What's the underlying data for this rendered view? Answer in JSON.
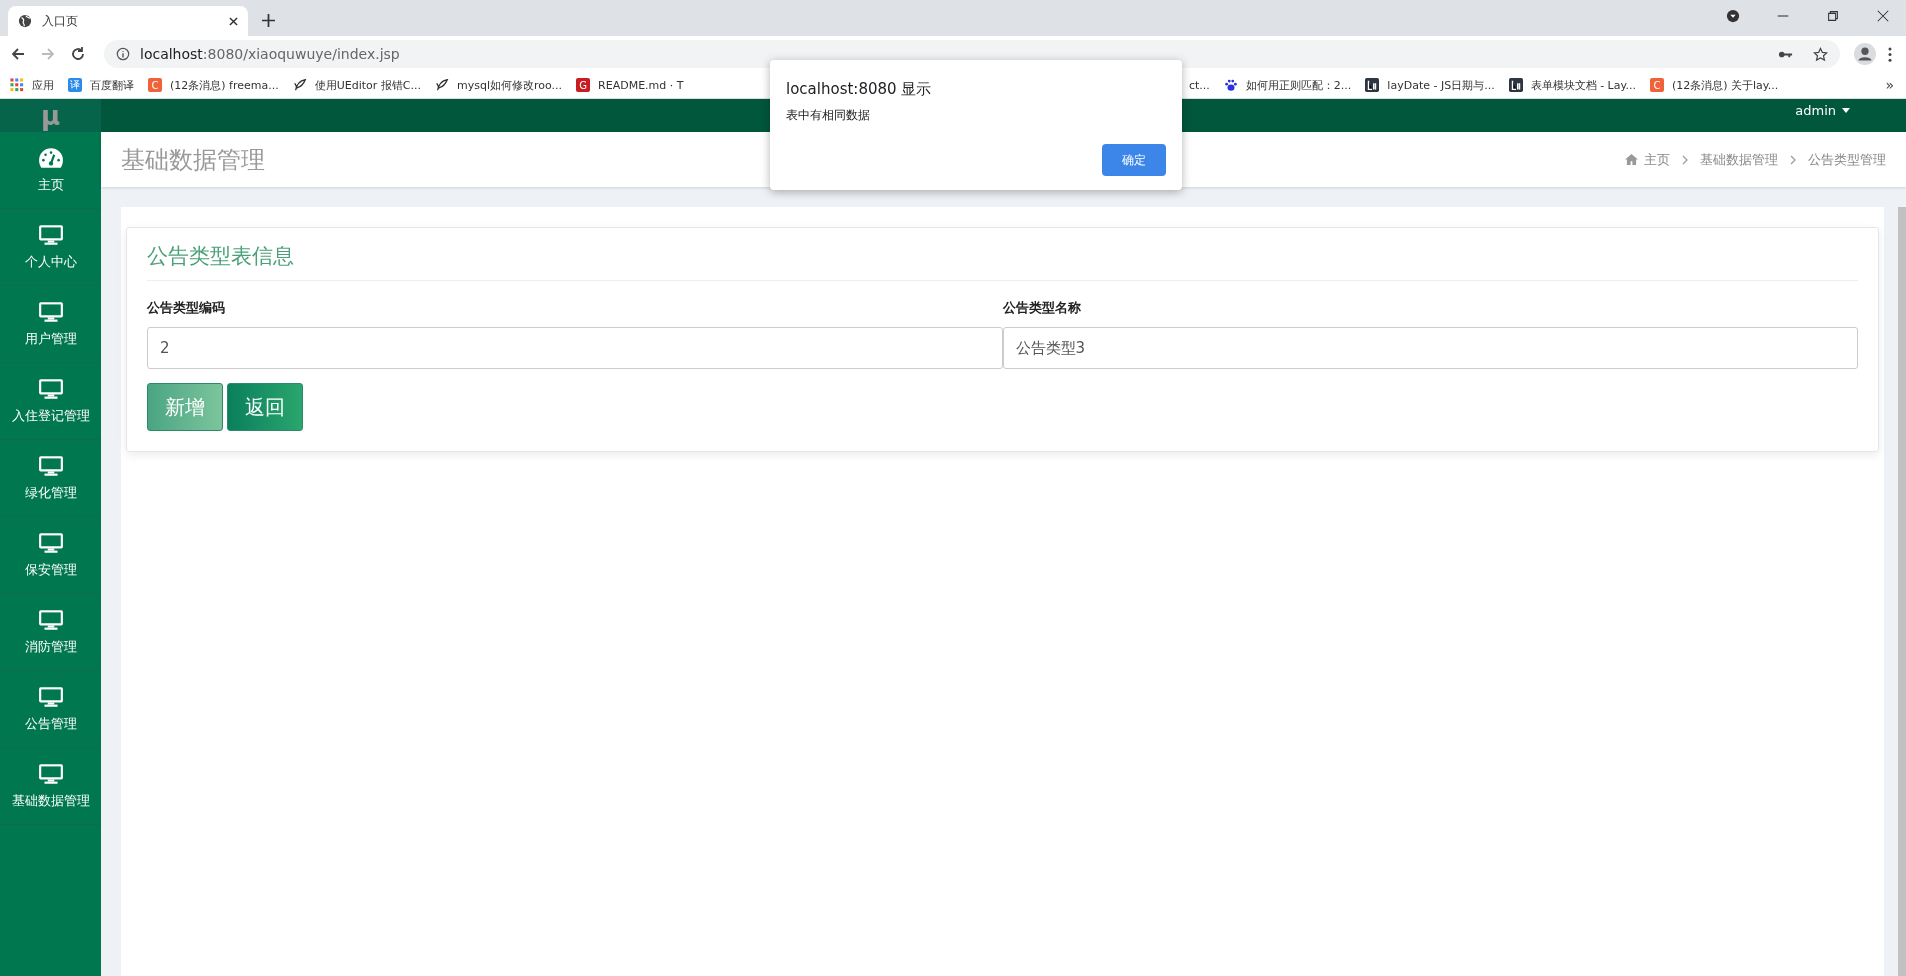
{
  "browser": {
    "tab": {
      "title": "入口页"
    },
    "address": {
      "host": "localhost",
      "rest": ":8080/xiaoquwuye/index.jsp"
    },
    "bookmarks_left": [
      {
        "kind": "apps",
        "label": "应用"
      },
      {
        "kind": "glyph",
        "glyph": "译",
        "color": "#2a8ce8",
        "label": "百度翻译"
      },
      {
        "kind": "glyph",
        "glyph": "C",
        "color": "#f0623a",
        "label": "(12条消息) freema..."
      },
      {
        "kind": "feather",
        "label": "使用UEditor 报错C..."
      },
      {
        "kind": "feather",
        "label": "mysql如何修改roo..."
      },
      {
        "kind": "glyph",
        "glyph": "G",
        "color": "#c71d23",
        "label": "README.md · T"
      }
    ],
    "bookmarks_right": [
      {
        "kind": "none",
        "label": "ct..."
      },
      {
        "kind": "paw",
        "label": "如何用正则匹配：2..."
      },
      {
        "kind": "layui",
        "label": "layDate - JS日期与..."
      },
      {
        "kind": "layui",
        "label": "表单模块文档 - Lay..."
      },
      {
        "kind": "glyph",
        "glyph": "C",
        "color": "#f0623a",
        "label": "(12条消息) 关于lay..."
      }
    ],
    "more": "»"
  },
  "dialog": {
    "title": "localhost:8080 显示",
    "message": "表中有相同数据",
    "ok": "确定"
  },
  "logo": "μ",
  "user": "admin",
  "sidebar": [
    {
      "kind": "dashboard",
      "label": "主页"
    },
    {
      "kind": "monitor",
      "label": "个人中心"
    },
    {
      "kind": "monitor",
      "label": "用户管理"
    },
    {
      "kind": "monitor",
      "label": "入住登记管理"
    },
    {
      "kind": "monitor",
      "label": "绿化管理"
    },
    {
      "kind": "monitor",
      "label": "保安管理"
    },
    {
      "kind": "monitor",
      "label": "消防管理"
    },
    {
      "kind": "monitor",
      "label": "公告管理"
    },
    {
      "kind": "monitor",
      "label": "基础数据管理"
    }
  ],
  "page_title": "基础数据管理",
  "breadcrumb": [
    "主页",
    "基础数据管理",
    "公告类型管理"
  ],
  "card": {
    "title": "公告类型表信息",
    "fields": [
      {
        "label": "公告类型编码",
        "value": "2"
      },
      {
        "label": "公告类型名称",
        "value": "公告类型3"
      }
    ],
    "buttons": [
      {
        "kind": "add",
        "label": "新增"
      },
      {
        "kind": "back",
        "label": "返回"
      }
    ]
  }
}
